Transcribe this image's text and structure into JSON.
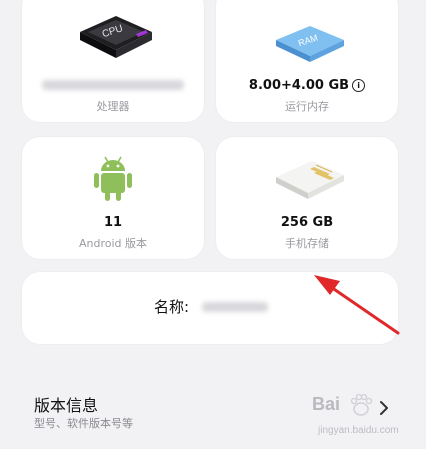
{
  "cards": {
    "cpu": {
      "icon_text": "CPU",
      "label": "处理器"
    },
    "ram": {
      "icon_text": "RAM",
      "value": "8.00+4.00 GB",
      "info_icon": "i",
      "label": "运行内存"
    },
    "android": {
      "value": "11",
      "label": "Android 版本"
    },
    "storage": {
      "value": "256 GB",
      "label": "手机存储"
    },
    "name": {
      "label": "名称:"
    }
  },
  "version_section": {
    "title": "版本信息",
    "subtitle": "型号、软件版本号等"
  },
  "watermark": {
    "text": "Bai",
    "sub": "jingyan.baidu.com"
  },
  "colors": {
    "background": "#f2f2f4",
    "card": "#ffffff",
    "label_gray": "#9a9aa0",
    "annotation_red": "#e0282b",
    "android_green": "#8fbf5a",
    "ram_blue": "#6aaee6"
  }
}
